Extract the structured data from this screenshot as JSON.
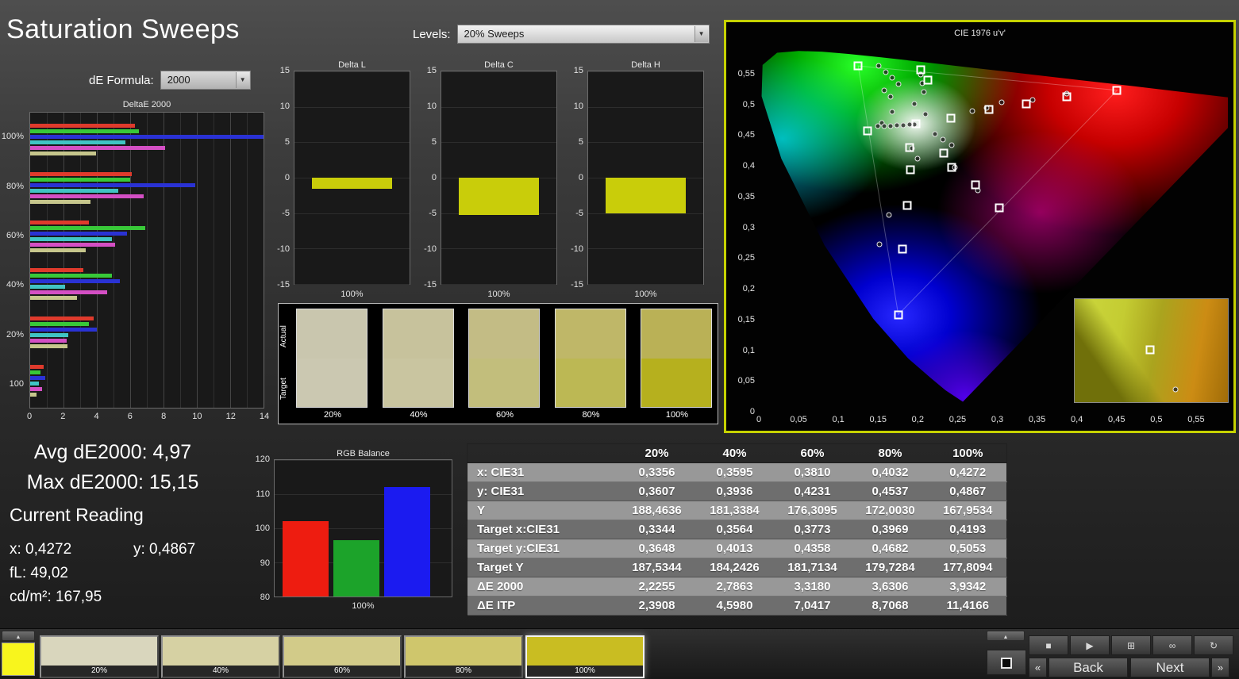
{
  "app": {
    "title": "Saturation Sweeps",
    "de_formula": {
      "label": "dE Formula:",
      "value": "2000"
    },
    "levels": {
      "label": "Levels:",
      "value": "20% Sweeps"
    }
  },
  "readings": {
    "avg": "Avg dE2000: 4,97",
    "max": "Max dE2000: 15,15",
    "current_title": "Current Reading",
    "x": "x: 0,4272",
    "y": "y: 0,4867",
    "fl": "fL: 49,02",
    "cd": "cd/m²: 167,95"
  },
  "swatch_panel": {
    "row_labels": [
      "Actual",
      "Target"
    ],
    "items": [
      {
        "label": "20%",
        "actual": "#c9c6ae",
        "target": "#cbc8b1"
      },
      {
        "label": "40%",
        "actual": "#c7c29c",
        "target": "#c9c5a0"
      },
      {
        "label": "60%",
        "actual": "#c3bc85",
        "target": "#c2be7c"
      },
      {
        "label": "80%",
        "actual": "#bfb768",
        "target": "#bcb854"
      },
      {
        "label": "100%",
        "actual": "#bab156",
        "target": "#b6b01e"
      }
    ]
  },
  "table": {
    "col_headers": [
      "",
      "20%",
      "40%",
      "60%",
      "80%",
      "100%"
    ],
    "rows": [
      {
        "label": "x: CIE31",
        "values": [
          "0,3356",
          "0,3595",
          "0,3810",
          "0,4032",
          "0,4272"
        ]
      },
      {
        "label": "y: CIE31",
        "values": [
          "0,3607",
          "0,3936",
          "0,4231",
          "0,4537",
          "0,4867"
        ]
      },
      {
        "label": "Y",
        "values": [
          "188,4636",
          "181,3384",
          "176,3095",
          "172,0030",
          "167,9534"
        ]
      },
      {
        "label": "Target x:CIE31",
        "values": [
          "0,3344",
          "0,3564",
          "0,3773",
          "0,3969",
          "0,4193"
        ]
      },
      {
        "label": "Target y:CIE31",
        "values": [
          "0,3648",
          "0,4013",
          "0,4358",
          "0,4682",
          "0,5053"
        ]
      },
      {
        "label": "Target Y",
        "values": [
          "187,5344",
          "184,2426",
          "181,7134",
          "179,7284",
          "177,8094"
        ]
      },
      {
        "label": "ΔE 2000",
        "values": [
          "2,2255",
          "2,7863",
          "3,3180",
          "3,6306",
          "3,9342"
        ]
      },
      {
        "label": "ΔE ITP",
        "values": [
          "2,3908",
          "4,5980",
          "7,0417",
          "8,7068",
          "11,4166"
        ]
      }
    ]
  },
  "chart_data": [
    {
      "id": "deltaE2000",
      "type": "bar",
      "orientation": "horizontal",
      "title": "DeltaE 2000",
      "categories": [
        "100%",
        "80%",
        "60%",
        "40%",
        "20%",
        "100"
      ],
      "xlim": [
        0,
        14
      ],
      "xticks": [
        0,
        2,
        4,
        6,
        8,
        10,
        12,
        14
      ],
      "series": [
        {
          "name": "red",
          "color": "#df3a2c",
          "values": [
            6.3,
            6.1,
            3.5,
            3.2,
            3.8,
            0.8
          ]
        },
        {
          "name": "green",
          "color": "#38c838",
          "values": [
            6.5,
            6.0,
            6.9,
            4.9,
            3.5,
            0.6
          ]
        },
        {
          "name": "blue",
          "color": "#2a32d4",
          "values": [
            15.15,
            9.9,
            5.8,
            5.4,
            4.0,
            0.9
          ]
        },
        {
          "name": "cyan",
          "color": "#40c4c4",
          "values": [
            5.7,
            5.3,
            4.9,
            2.1,
            2.3,
            0.5
          ]
        },
        {
          "name": "magenta",
          "color": "#d44fc4",
          "values": [
            8.1,
            6.8,
            5.1,
            4.6,
            2.2,
            0.7
          ]
        },
        {
          "name": "yellow",
          "color": "#c6c68c",
          "values": [
            3.93,
            3.63,
            3.32,
            2.79,
            2.23,
            0.4
          ]
        }
      ]
    },
    {
      "id": "deltaL",
      "type": "bar",
      "title": "Delta L",
      "categories": [
        "100%"
      ],
      "values": [
        -1.6
      ],
      "ylim": [
        -15,
        15
      ],
      "yticks": [
        15,
        10,
        5,
        0,
        -5,
        -10,
        -15
      ],
      "color": "#c9cd0a"
    },
    {
      "id": "deltaC",
      "type": "bar",
      "title": "Delta C",
      "categories": [
        "100%"
      ],
      "values": [
        -5.3
      ],
      "ylim": [
        -15,
        15
      ],
      "yticks": [
        15,
        10,
        5,
        0,
        -5,
        -10,
        -15
      ],
      "color": "#c9cd0a"
    },
    {
      "id": "deltaH",
      "type": "bar",
      "title": "Delta H",
      "categories": [
        "100%"
      ],
      "values": [
        -5.0
      ],
      "ylim": [
        -15,
        15
      ],
      "yticks": [
        15,
        10,
        5,
        0,
        -5,
        -10,
        -15
      ],
      "color": "#c9cd0a"
    },
    {
      "id": "rgbBalance",
      "type": "bar",
      "title": "RGB Balance",
      "categories": [
        "Red",
        "Green",
        "Blue"
      ],
      "values": [
        102,
        96.5,
        112
      ],
      "colors": [
        "#ee1c10",
        "#1ca32a",
        "#1b1bf0"
      ],
      "ylim": [
        80,
        120
      ],
      "yticks": [
        120,
        110,
        100,
        90,
        80
      ],
      "xlabel": "100%"
    },
    {
      "id": "cie",
      "type": "scatter",
      "title": "CIE 1976 u'v'",
      "xlim": [
        0,
        0.59
      ],
      "ylim": [
        0,
        0.6
      ],
      "xtick_values": [
        0,
        0.05,
        0.1,
        0.15,
        0.2,
        0.25,
        0.3,
        0.35,
        0.4,
        0.45,
        0.5,
        0.55
      ],
      "xtick_labels": [
        "0",
        "0,05",
        "0,1",
        "0,15",
        "0,2",
        "0,25",
        "0,3",
        "0,35",
        "0,4",
        "0,45",
        "0,5",
        "0,55"
      ],
      "ytick_values": [
        0,
        0.05,
        0.1,
        0.15,
        0.2,
        0.25,
        0.3,
        0.35,
        0.4,
        0.45,
        0.5,
        0.55
      ],
      "ytick_labels": [
        "0",
        "0,05",
        "0,1",
        "0,15",
        "0,2",
        "0,25",
        "0,3",
        "0,35",
        "0,4",
        "0,45",
        "0,5",
        "0,55"
      ],
      "gamut_triangle": [
        [
          0.125,
          0.5625
        ],
        [
          0.4507,
          0.5229
        ],
        [
          0.1754,
          0.1579
        ]
      ],
      "targets": [
        [
          0.125,
          0.5625
        ],
        [
          0.204,
          0.556
        ],
        [
          0.213,
          0.54
        ],
        [
          0.4507,
          0.5229
        ],
        [
          0.387,
          0.512
        ],
        [
          0.336,
          0.501
        ],
        [
          0.29,
          0.491
        ],
        [
          0.242,
          0.478
        ],
        [
          0.1978,
          0.4683
        ],
        [
          0.137,
          0.457
        ],
        [
          0.19,
          0.43
        ],
        [
          0.233,
          0.421
        ],
        [
          0.243,
          0.398
        ],
        [
          0.191,
          0.393
        ],
        [
          0.273,
          0.369
        ],
        [
          0.187,
          0.335
        ],
        [
          0.302,
          0.331
        ],
        [
          0.181,
          0.264
        ],
        [
          0.1754,
          0.1579
        ]
      ],
      "measurements": [
        [
          0.151,
          0.562
        ],
        [
          0.16,
          0.552
        ],
        [
          0.168,
          0.543
        ],
        [
          0.176,
          0.533
        ],
        [
          0.158,
          0.522
        ],
        [
          0.166,
          0.512
        ],
        [
          0.204,
          0.548
        ],
        [
          0.206,
          0.534
        ],
        [
          0.208,
          0.52
        ],
        [
          0.196,
          0.5
        ],
        [
          0.21,
          0.484
        ],
        [
          0.168,
          0.488
        ],
        [
          0.155,
          0.47
        ],
        [
          0.15,
          0.464
        ],
        [
          0.158,
          0.4645
        ],
        [
          0.166,
          0.465
        ],
        [
          0.174,
          0.4655
        ],
        [
          0.182,
          0.466
        ],
        [
          0.19,
          0.4665
        ],
        [
          0.196,
          0.467
        ],
        [
          0.222,
          0.452
        ],
        [
          0.232,
          0.443
        ],
        [
          0.243,
          0.434
        ],
        [
          0.269,
          0.489
        ],
        [
          0.287,
          0.494
        ],
        [
          0.305,
          0.503
        ],
        [
          0.344,
          0.507
        ],
        [
          0.387,
          0.517
        ],
        [
          0.193,
          0.428
        ],
        [
          0.2,
          0.412
        ],
        [
          0.247,
          0.398
        ],
        [
          0.276,
          0.36
        ],
        [
          0.164,
          0.32
        ],
        [
          0.152,
          0.272
        ]
      ],
      "inset": {
        "square": [
          0.49,
          0.49
        ],
        "dot": [
          0.66,
          0.88
        ]
      }
    }
  ],
  "bottom_bar": {
    "patch_color": "#f8f51d",
    "swatches": [
      {
        "label": "20%",
        "color": "#d9d6bd",
        "selected": false
      },
      {
        "label": "40%",
        "color": "#d6d1a3",
        "selected": false
      },
      {
        "label": "60%",
        "color": "#d2cb89",
        "selected": false
      },
      {
        "label": "80%",
        "color": "#cfc66c",
        "selected": false
      },
      {
        "label": "100%",
        "color": "#c9bd22",
        "selected": true
      }
    ],
    "collapse_icon": "▲",
    "controls": {
      "stop_icon": "■",
      "play_icon": "▶",
      "fit_icon": "⊞",
      "loop_icon": "∞",
      "refresh_icon": "↻",
      "prev_icon": "«",
      "back_label": "Back",
      "next_label": "Next",
      "forward_icon": "»"
    }
  }
}
